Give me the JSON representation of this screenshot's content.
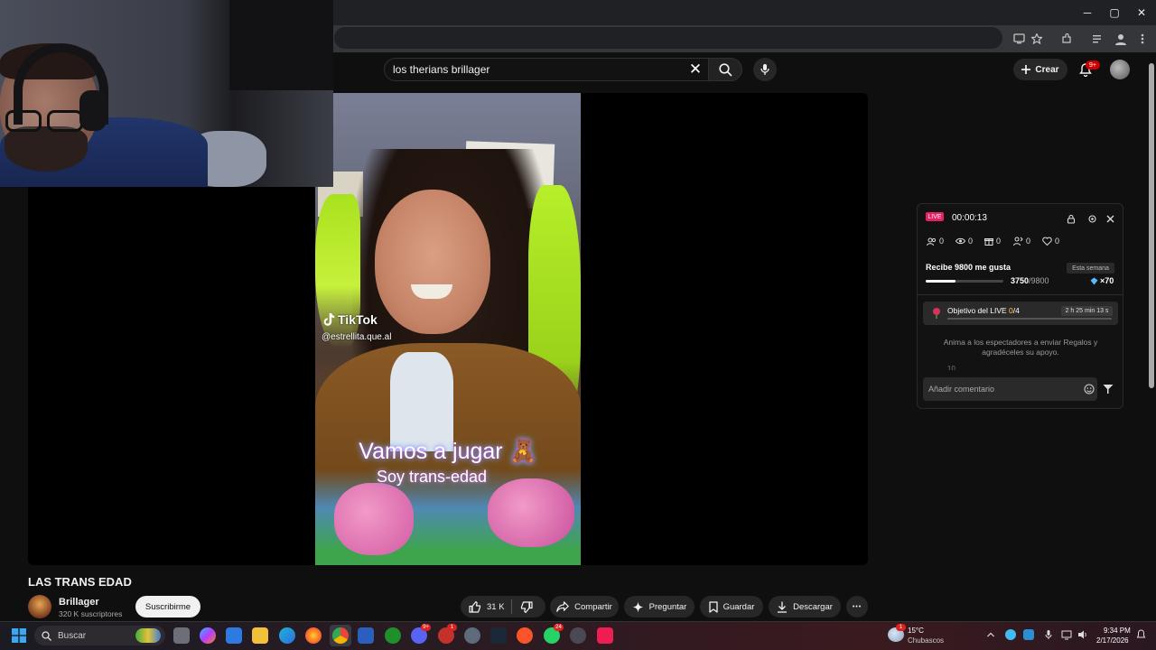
{
  "browser": {
    "window_controls": {
      "minimize": "─",
      "maximize": "▢",
      "close": "✕"
    }
  },
  "youtube": {
    "search": {
      "query": "los therians brillager",
      "clear_glyph": "✕"
    },
    "create_label": "Crear",
    "notifications_badge": "9+"
  },
  "video": {
    "title": "LAS TRANS EDAD",
    "overlay": {
      "tiktok_brand": "TikTok",
      "tiktok_handle": "@estrellita.que.al",
      "caption_line1": "Vamos a jugar 🧸",
      "caption_line2": "Soy trans-edad"
    }
  },
  "channel": {
    "name": "Brillager",
    "subscribers": "320 K suscriptores",
    "subscribe_label": "Suscribirme"
  },
  "actions": {
    "likes": "31 K",
    "share": "Compartir",
    "ask": "Preguntar",
    "save": "Guardar",
    "download": "Descargar",
    "more": "•••"
  },
  "live_panel": {
    "badge": "LIVE",
    "timer": "00:00:13",
    "stats": {
      "viewers": "0",
      "views": "0",
      "gifts": "0",
      "shares": "0",
      "likes": "0"
    },
    "likes_goal": {
      "title": "Recibe 9800 me gusta",
      "period": "Esta semana",
      "current": "3750",
      "target": "/9800",
      "multiplier": "×70",
      "progress": 0.383
    },
    "objective": {
      "label": "Objetivo del LIVE ",
      "current": "0",
      "total": "/4",
      "time_left": "2 h 25 min 13 s"
    },
    "hint": "Anima a los espectadores a enviar Regalos y agradéceles su apoyo.",
    "hint_cut": "... 10 ... ...",
    "comment_placeholder": "Añadir comentario"
  },
  "taskbar": {
    "search_label": "Buscar",
    "badges": {
      "discord": "9+",
      "app_red": "1",
      "brave": "24"
    },
    "weather": {
      "temp": "15°C",
      "desc": "Chubascos",
      "badge": "1"
    },
    "clock": {
      "time": "9:34 PM",
      "date": "2/17/2026"
    }
  },
  "colors": {
    "live_pink": "#e91e63",
    "subscribe_bg": "#f1f1f1",
    "notification_red": "#cc0000"
  }
}
